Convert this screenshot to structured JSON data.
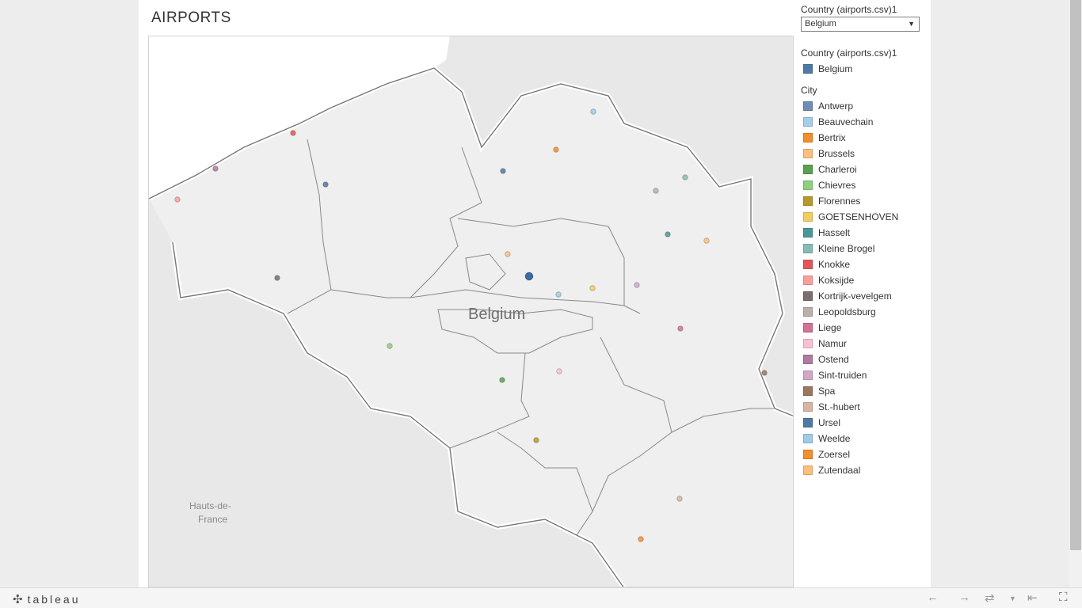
{
  "page": {
    "title": "AIRPORTS"
  },
  "filter": {
    "title": "Country (airports.csv)1",
    "selected": "Belgium"
  },
  "legend_country": {
    "title": "Country (airports.csv)1",
    "items": [
      {
        "label": "Belgium",
        "color": "#4e79a7"
      }
    ]
  },
  "legend_city": {
    "title": "City",
    "items": [
      {
        "label": "Antwerp",
        "color": "#6f8db5"
      },
      {
        "label": "Beauvechain",
        "color": "#a6cde8"
      },
      {
        "label": "Bertrix",
        "color": "#f28e2b"
      },
      {
        "label": "Brussels",
        "color": "#ffbe7d"
      },
      {
        "label": "Charleroi",
        "color": "#59a14f"
      },
      {
        "label": "Chievres",
        "color": "#8cd17d"
      },
      {
        "label": "Florennes",
        "color": "#b6992d"
      },
      {
        "label": "GOETSENHOVEN",
        "color": "#f1ce63"
      },
      {
        "label": "Hasselt",
        "color": "#499894"
      },
      {
        "label": "Kleine Brogel",
        "color": "#86bcb6"
      },
      {
        "label": "Knokke",
        "color": "#e15759"
      },
      {
        "label": "Koksijde",
        "color": "#ff9d9a"
      },
      {
        "label": "Kortrijk-vevelgem",
        "color": "#79706e"
      },
      {
        "label": "Leopoldsburg",
        "color": "#bab0ac"
      },
      {
        "label": "Liege",
        "color": "#d37295"
      },
      {
        "label": "Namur",
        "color": "#fabfd2"
      },
      {
        "label": "Ostend",
        "color": "#b07aa1"
      },
      {
        "label": "Sint-truiden",
        "color": "#d4a6c8"
      },
      {
        "label": "Spa",
        "color": "#9d7660"
      },
      {
        "label": "St.-hubert",
        "color": "#d7b5a6"
      },
      {
        "label": "Ursel",
        "color": "#4e79a7"
      },
      {
        "label": "Weelde",
        "color": "#a0cbe8"
      },
      {
        "label": "Zoersel",
        "color": "#f28e2b"
      },
      {
        "label": "Zutendaal",
        "color": "#ffbe7d"
      }
    ]
  },
  "map": {
    "country_label": "Belgium",
    "region_label_line1": "Hauts-de-",
    "region_label_line2": "France",
    "points": [
      {
        "city": "Knokke",
        "color": "#e15759"
      },
      {
        "city": "Ostend",
        "color": "#b07aa1"
      },
      {
        "city": "Koksijde",
        "color": "#ff9d9a"
      },
      {
        "city": "Ursel",
        "color": "#4e79a7"
      },
      {
        "city": "Kortrijk-vevelgem",
        "color": "#79706e"
      },
      {
        "city": "Chievres",
        "color": "#8cd17d"
      },
      {
        "city": "Antwerp",
        "color": "#4e79a7"
      },
      {
        "city": "Zoersel",
        "color": "#f28e2b"
      },
      {
        "city": "Weelde",
        "color": "#a0cbe8"
      },
      {
        "city": "Leopoldsburg",
        "color": "#bab0ac"
      },
      {
        "city": "Kleine Brogel",
        "color": "#86bcb6"
      },
      {
        "city": "Hasselt",
        "color": "#499894"
      },
      {
        "city": "Zutendaal",
        "color": "#ffbe7d"
      },
      {
        "city": "Brussels",
        "color": "#ffbe7d"
      },
      {
        "city": "Belgium",
        "color": "#3e6aa0"
      },
      {
        "city": "Beauvechain",
        "color": "#a0cbe8"
      },
      {
        "city": "GOETSENHOVEN",
        "color": "#f1ce63"
      },
      {
        "city": "Sint-truiden",
        "color": "#d4a6c8"
      },
      {
        "city": "Liege",
        "color": "#d37295"
      },
      {
        "city": "Spa",
        "color": "#9d7660"
      },
      {
        "city": "Charleroi",
        "color": "#59a14f"
      },
      {
        "city": "Namur",
        "color": "#fabfd2"
      },
      {
        "city": "Florennes",
        "color": "#b6992d"
      },
      {
        "city": "St.-hubert",
        "color": "#d7b5a6"
      },
      {
        "city": "Bertrix",
        "color": "#f28e2b"
      }
    ]
  },
  "toolbar": {
    "logo_text": "tableau"
  }
}
